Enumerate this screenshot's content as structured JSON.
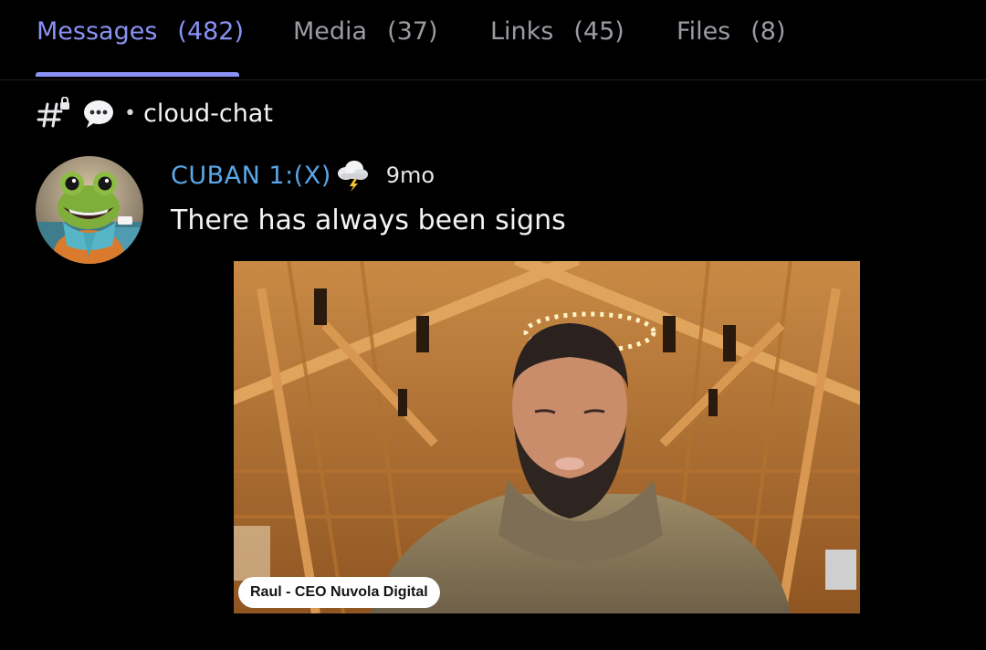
{
  "tabs": [
    {
      "label": "Messages",
      "count": "(482)"
    },
    {
      "label": "Media",
      "count": "(37)"
    },
    {
      "label": "Links",
      "count": "(45)"
    },
    {
      "label": "Files",
      "count": "(8)"
    }
  ],
  "channel": {
    "separator": "•",
    "name": "cloud-chat"
  },
  "message": {
    "username": "CUBAN 1:(X)",
    "timestamp": "9mo",
    "text": "There has always been signs",
    "media_caption": "Raul - CEO Nuvola Digital"
  },
  "colors": {
    "accent": "#8a93f5",
    "username": "#5aa7e8",
    "background": "#000000"
  },
  "icons": [
    "hashtag-lock-icon",
    "speech-bubble-icon",
    "thundercloud-emoji-icon"
  ]
}
